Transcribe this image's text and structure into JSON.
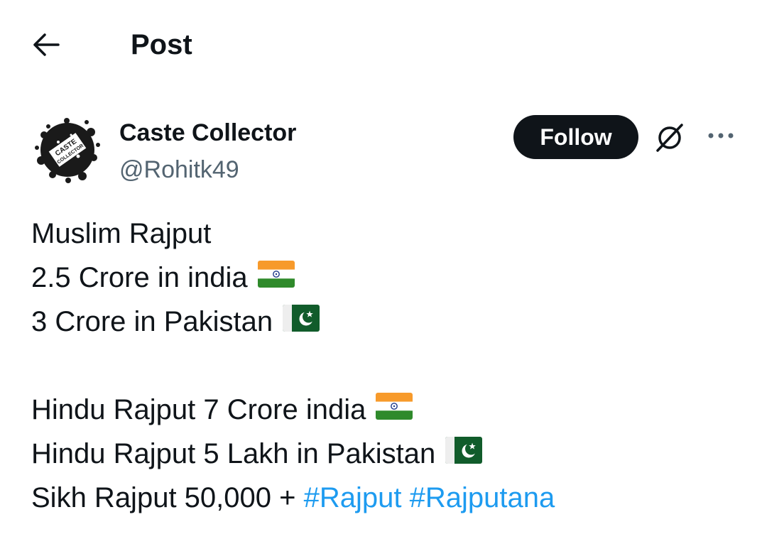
{
  "header": {
    "back_icon": "arrow-left-icon",
    "title": "Post"
  },
  "author": {
    "avatar_text": "CASTE COLLECTOR",
    "name": "Caste Collector",
    "handle": "@Rohitk49",
    "follow_label": "Follow",
    "grok_icon": "grok-icon",
    "more_icon": "more-horizontal-icon"
  },
  "post": {
    "lines": [
      {
        "text": "Muslim Rajput",
        "flag": null
      },
      {
        "text": "2.5 Crore in india",
        "flag": "india"
      },
      {
        "text": "3 Crore in Pakistan",
        "flag": "pakistan"
      },
      {
        "text": "",
        "flag": null
      },
      {
        "text": "Hindu Rajput 7 Crore india",
        "flag": "india"
      },
      {
        "text": "Hindu Rajput 5 Lakh in Pakistan",
        "flag": "pakistan"
      },
      {
        "text": "Sikh Rajput 50,000 +",
        "flag": null
      }
    ],
    "hashtags": [
      "#Rajput",
      "#Rajputana"
    ]
  },
  "colors": {
    "text": "#0f1419",
    "secondary": "#536471",
    "link": "#1d9bf0",
    "follow_bg": "#0f1419",
    "follow_text": "#ffffff"
  }
}
